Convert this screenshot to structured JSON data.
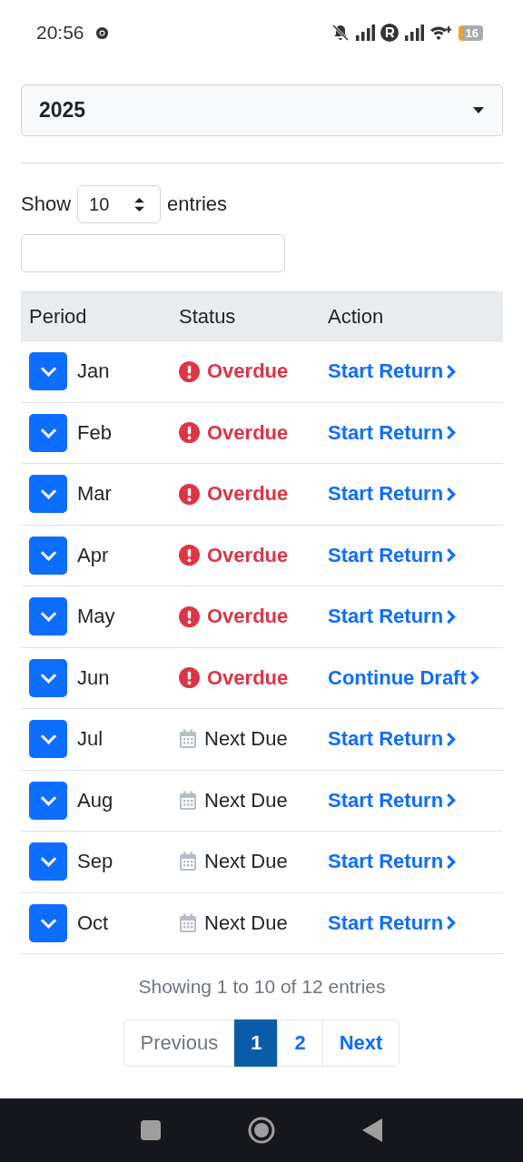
{
  "status_bar": {
    "time": "20:56",
    "battery": "16"
  },
  "year_select": {
    "value": "2025"
  },
  "length_control": {
    "show": "Show",
    "value": "10",
    "entries": "entries"
  },
  "table": {
    "columns": [
      "Period",
      "Status",
      "Action"
    ],
    "rows": [
      {
        "period": "Jan",
        "status": "Overdue",
        "kind": "overdue",
        "action": "Start Return"
      },
      {
        "period": "Feb",
        "status": "Overdue",
        "kind": "overdue",
        "action": "Start Return"
      },
      {
        "period": "Mar",
        "status": "Overdue",
        "kind": "overdue",
        "action": "Start Return"
      },
      {
        "period": "Apr",
        "status": "Overdue",
        "kind": "overdue",
        "action": "Start Return"
      },
      {
        "period": "May",
        "status": "Overdue",
        "kind": "overdue",
        "action": "Start Return"
      },
      {
        "period": "Jun",
        "status": "Overdue",
        "kind": "overdue",
        "action": "Continue Draft"
      },
      {
        "period": "Jul",
        "status": "Next Due",
        "kind": "upcoming",
        "action": "Start Return"
      },
      {
        "period": "Aug",
        "status": "Next Due",
        "kind": "upcoming",
        "action": "Start Return"
      },
      {
        "period": "Sep",
        "status": "Next Due",
        "kind": "upcoming",
        "action": "Start Return"
      },
      {
        "period": "Oct",
        "status": "Next Due",
        "kind": "upcoming",
        "action": "Start Return"
      }
    ]
  },
  "info": "Showing 1 to 10 of 12 entries",
  "pagination": [
    {
      "label": "Previous",
      "selected": false,
      "disabled": true
    },
    {
      "label": "1",
      "selected": true,
      "disabled": false
    },
    {
      "label": "2",
      "selected": false,
      "disabled": false
    },
    {
      "label": "Next",
      "selected": false,
      "disabled": false
    }
  ]
}
